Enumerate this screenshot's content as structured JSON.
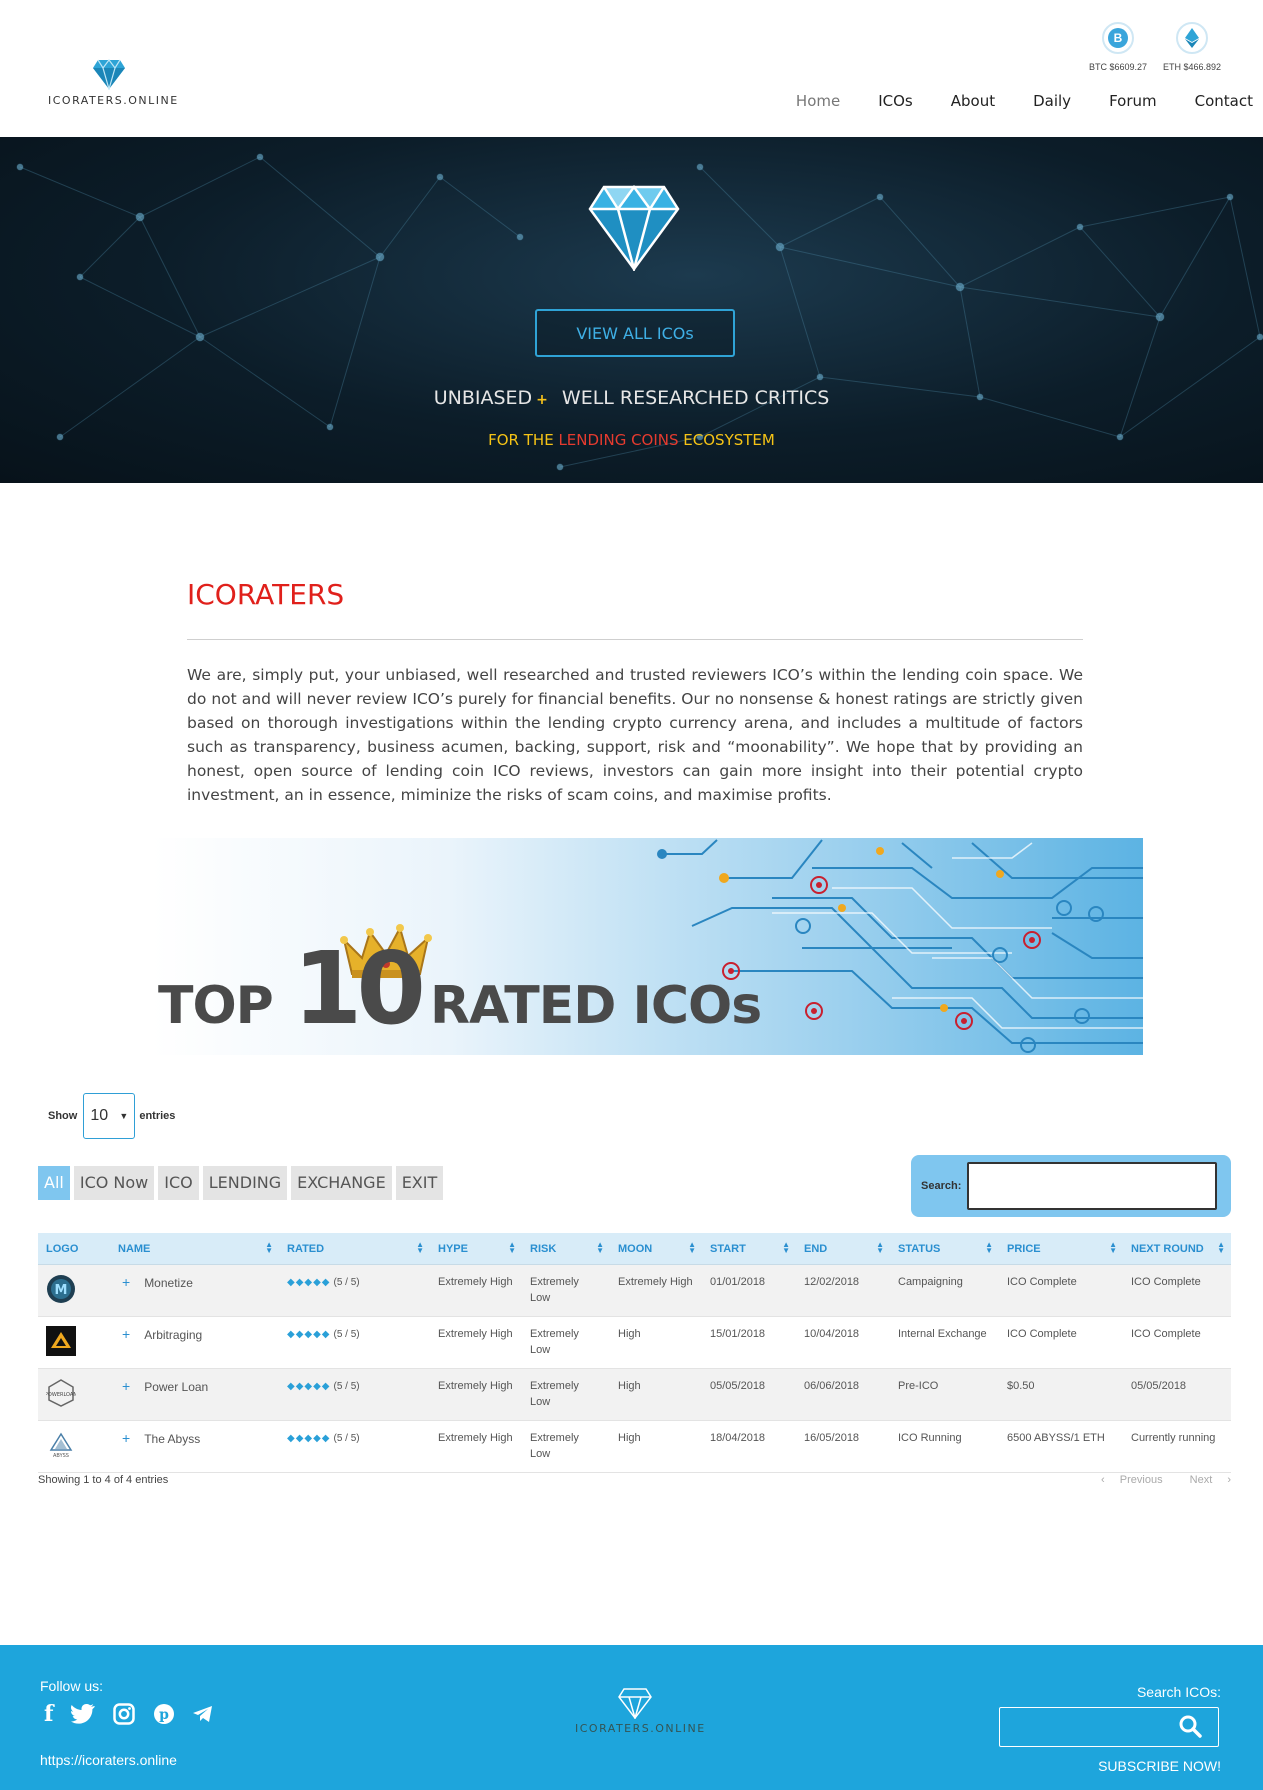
{
  "header": {
    "logo_text": "ICORATERS.ONLINE",
    "btc_label": "BTC $6609.27",
    "eth_label": "ETH $466.892",
    "nav": [
      "Home",
      "ICOs",
      "About",
      "Daily",
      "Forum",
      "Contact"
    ],
    "active_nav": "Home"
  },
  "hero": {
    "button_label": "VIEW ALL ICOs",
    "tagline_a": "UNBIASED",
    "tagline_plus": "+",
    "tagline_b": "WELL RESEARCHED CRITICS",
    "sub_a": "FOR THE ",
    "sub_red": "LENDING COINS",
    "sub_b": " ECOSYSTEM"
  },
  "about": {
    "title": "ICORATERS",
    "text": "We are, simply put, your unbiased, well researched and trusted reviewers ICO’s within the lending coin space. We do not and will never review ICO’s purely for financial benefits. Our no nonsense & honest ratings are strictly given based on thorough investigations within the lending crypto currency arena, and includes a multitude of factors such as transparency, business acumen, backing, support, risk and “moonability”. We hope that by providing an honest, open source of lending coin ICO reviews, investors can gain more insight into their potential crypto investment, an in essence, miminize the risks of scam coins, and maximise profits."
  },
  "banner": {
    "word1": "TOP",
    "word2": "10",
    "word3": "RATED ICOs"
  },
  "table_controls": {
    "show_label": "Show",
    "show_value": "10",
    "entries_label": "entries",
    "filters": [
      "All",
      "ICO Now",
      "ICO",
      "LENDING",
      "EXCHANGE",
      "EXIT"
    ],
    "active_filter": "All",
    "search_label": "Search:"
  },
  "table": {
    "columns": [
      "LOGO",
      "NAME",
      "RATED",
      "HYPE",
      "RISK",
      "MOON",
      "START",
      "END",
      "STATUS",
      "PRICE",
      "NEXT ROUND"
    ],
    "rows": [
      {
        "logo_icon": "monetize-logo-icon",
        "name": "Monetize",
        "rating": "(5 / 5)",
        "hype": "Extremely High",
        "risk": "Extremely Low",
        "moon": "Extremely High",
        "start": "01/01/2018",
        "end": "12/02/2018",
        "status": "Campaigning",
        "price": "ICO Complete",
        "next_round": "ICO Complete"
      },
      {
        "logo_icon": "arbitraging-logo-icon",
        "name": "Arbitraging",
        "rating": "(5 / 5)",
        "hype": "Extremely High",
        "risk": "Extremely Low",
        "moon": "High",
        "start": "15/01/2018",
        "end": "10/04/2018",
        "status": "Internal Exchange",
        "price": "ICO Complete",
        "next_round": "ICO Complete"
      },
      {
        "logo_icon": "powerloan-logo-icon",
        "name": "Power Loan",
        "rating": "(5 / 5)",
        "hype": "Extremely High",
        "risk": "Extremely Low",
        "moon": "High",
        "start": "05/05/2018",
        "end": "06/06/2018",
        "status": "Pre-ICO",
        "price": "$0.50",
        "next_round": "05/05/2018"
      },
      {
        "logo_icon": "abyss-logo-icon",
        "name": "The Abyss",
        "rating": "(5 / 5)",
        "hype": "Extremely High",
        "risk": "Extremely Low",
        "moon": "High",
        "start": "18/04/2018",
        "end": "16/05/2018",
        "status": "ICO Running",
        "price": "6500 ABYSS/1 ETH",
        "next_round": "Currently running"
      }
    ],
    "info": "Showing 1 to 4 of 4 entries",
    "prev_label": "Previous",
    "next_label": "Next"
  },
  "footer": {
    "follow_label": "Follow us:",
    "social_icons": [
      "facebook-icon",
      "twitter-icon",
      "instagram-icon",
      "pinterest-icon",
      "telegram-icon"
    ],
    "url": "https://icoraters.online",
    "logo_text": "ICORATERS.ONLINE",
    "search_label": "Search ICOs:",
    "subscribe_label": "SUBSCRIBE NOW!"
  },
  "colors": {
    "accent": "#2a8fd0",
    "footer_bg": "#1ea5dc",
    "title_red": "#e0201b",
    "hero_yellow": "#f5c316"
  }
}
